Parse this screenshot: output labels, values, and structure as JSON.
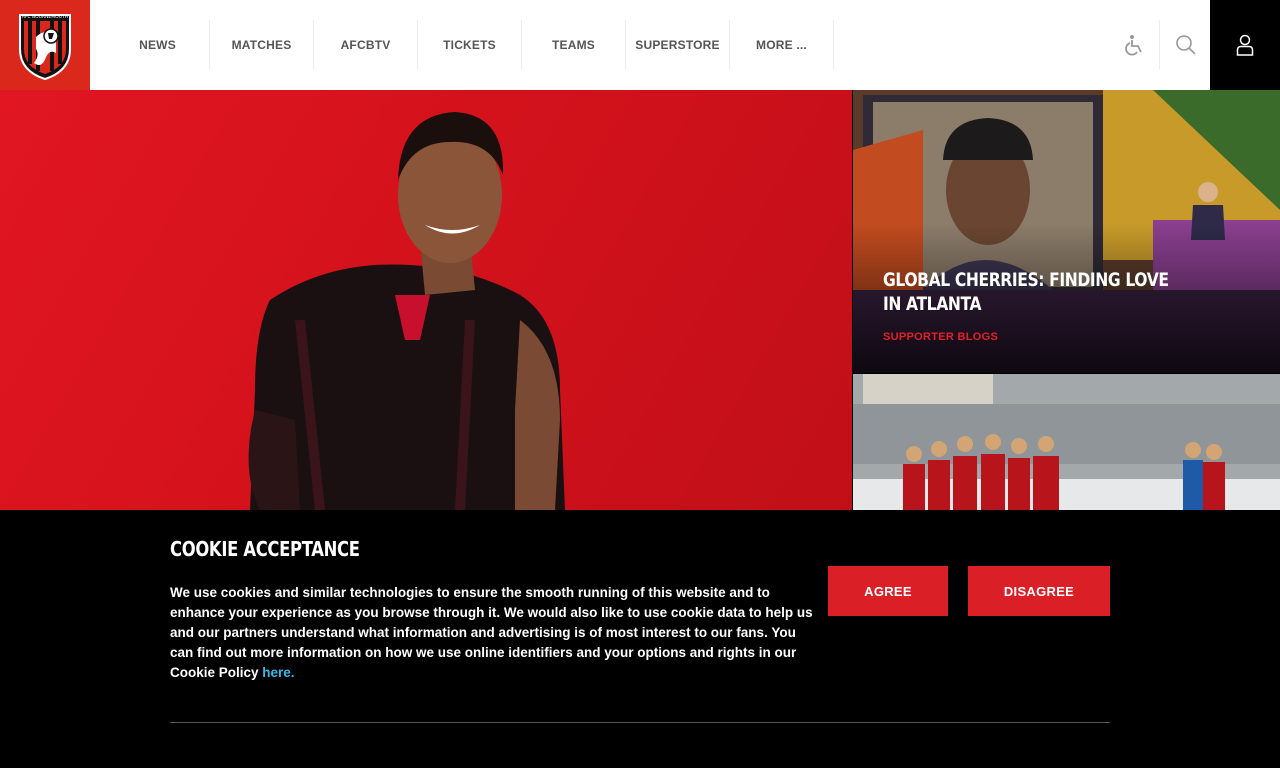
{
  "header": {
    "logo_text": "AFC BOURNEMOUTH",
    "nav": [
      {
        "label": "NEWS"
      },
      {
        "label": "MATCHES"
      },
      {
        "label": "AFCBTV"
      },
      {
        "label": "TICKETS"
      },
      {
        "label": "TEAMS"
      },
      {
        "label": "SUPERSTORE"
      },
      {
        "label": "MORE ..."
      }
    ],
    "icons": {
      "accessibility": "accessibility-icon",
      "search": "search-icon",
      "account": "user-icon"
    }
  },
  "cards": {
    "feature": {
      "title": "GLOBAL CHERRIES: FINDING LOVE IN ATLANTA",
      "category": "SUPPORTER BLOGS"
    }
  },
  "cookie": {
    "title": "COOKIE ACCEPTANCE",
    "body": "We use cookies and similar technologies to ensure the smooth running of this website and to enhance your experience as you browse through it. We would also like to use cookie data to help us and our partners understand what information and advertising is of most interest to our fans. You can find out more information on how we use online identifiers and your options and rights in our Cookie Policy ",
    "link_text": "here.",
    "agree_label": "AGREE",
    "disagree_label": "DISAGREE"
  },
  "colors": {
    "brand_red": "#da291c",
    "button_red": "#da1f26",
    "link_blue": "#3ab7e6"
  }
}
